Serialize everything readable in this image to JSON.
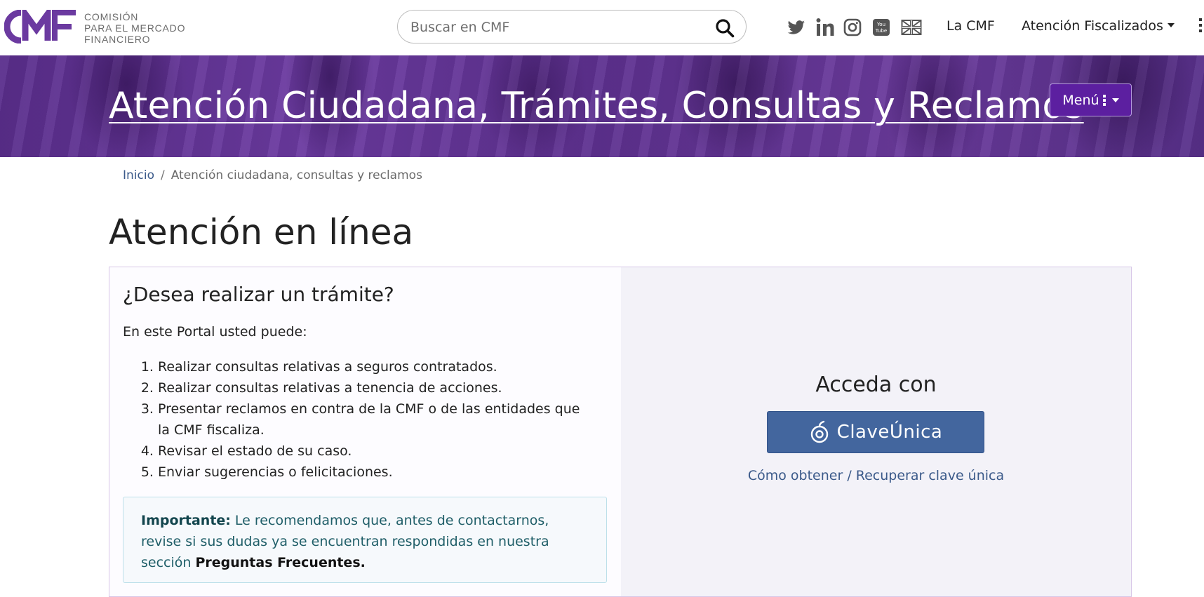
{
  "header": {
    "logo_lines": [
      "COMISIÓN",
      "PARA EL MERCADO",
      "FINANCIERO"
    ],
    "search": {
      "placeholder": "Buscar en CMF",
      "value": ""
    },
    "social_icons": [
      "twitter-icon",
      "linkedin-icon",
      "instagram-icon",
      "youtube-icon",
      "uk-flag-icon"
    ],
    "nav": {
      "la_cmf": "La CMF",
      "atencion_fiscalizados": "Atención Fiscalizados"
    }
  },
  "banner": {
    "title": "Atención Ciudadana, Trámites, Consultas y Reclamos",
    "menu_label": "Menú"
  },
  "breadcrumb": {
    "home": "Inicio",
    "separator": "/",
    "current": "Atención ciudadana, consultas y reclamos"
  },
  "page_title": "Atención en línea",
  "tramite": {
    "heading": "¿Desea realizar un trámite?",
    "intro": "En este Portal usted puede:",
    "options": [
      "Realizar consultas relativas a seguros contratados.",
      "Realizar consultas relativas a tenencia de acciones.",
      "Presentar reclamos en contra de la CMF o de las entidades que la CMF fiscaliza.",
      "Revisar el estado de su caso.",
      "Enviar sugerencias o felicitaciones."
    ],
    "notice": {
      "label": "Importante:",
      "text": " Le recomendamos que, antes de contactarnos, revise si sus dudas ya se encuentran respondidas en nuestra sección ",
      "link": "Preguntas Frecuentes."
    }
  },
  "access": {
    "title": "Acceda con",
    "button_label": "ClaveÚnica",
    "help_link": "Cómo obtener / Recuperar clave única"
  },
  "colors": {
    "brand_purple": "#6b3aa0",
    "menu_button": "#5c1fa0",
    "clave_button": "#43669e",
    "link_blue": "#3b5a8a",
    "notice_text": "#1f5e68"
  }
}
